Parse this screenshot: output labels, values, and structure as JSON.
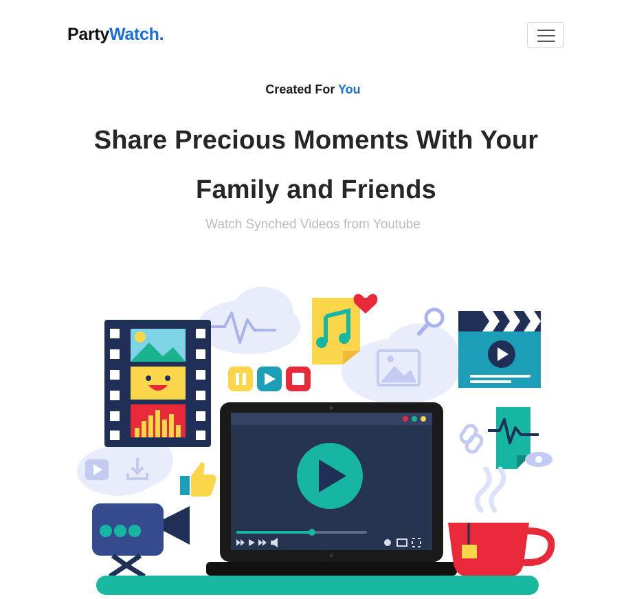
{
  "navbar": {
    "brand_prefix": "Party",
    "brand_accent": "Watch.",
    "menu_icon": "hamburger-icon"
  },
  "hero": {
    "eyebrow_prefix": "Created For ",
    "eyebrow_accent": "You",
    "headline": "Share Precious Moments With Your Family and Friends",
    "subline": "Watch Synched Videos from Youtube",
    "illustration": "video-streaming-illustration"
  },
  "colors": {
    "accent": "#1a6fe0",
    "teal": "#16b6a2",
    "navy": "#1f2f56",
    "red": "#e8293a",
    "yellow": "#fbd54a"
  }
}
